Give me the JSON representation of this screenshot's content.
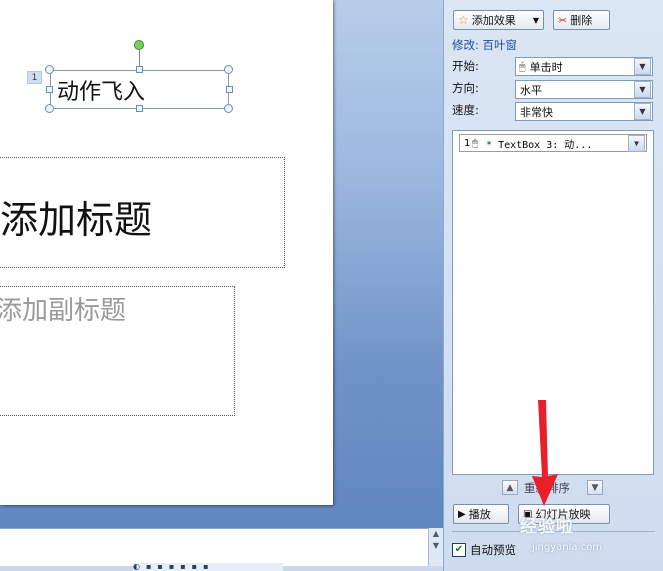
{
  "slide": {
    "textbox_text": "动作飞入",
    "order_tag": "1",
    "title_placeholder": "添加标题",
    "subtitle_placeholder": "添加副标题"
  },
  "pane": {
    "add_effect_label": "添加效果",
    "delete_label": "删除",
    "modify_label": "修改: 百叶窗",
    "start_label": "开始:",
    "start_value": "单击时",
    "direction_label": "方向:",
    "direction_value": "水平",
    "speed_label": "速度:",
    "speed_value": "非常快",
    "list_item": {
      "index": "1",
      "text": "TextBox 3: 动..."
    },
    "reorder_label": "重新排序",
    "play_label": "播放",
    "slideshow_label": "幻灯片放映",
    "autopreview_label": "自动预览",
    "autopreview_checked": true
  },
  "watermark": {
    "text": "经验啦",
    "url": "jingyanla.com"
  },
  "colors": {
    "accent": "#1a4d9c",
    "arrow": "#e8202a",
    "pane_bg": "#dbe6f4"
  },
  "icons": [
    "add-effect-star-icon",
    "delete-icon",
    "mouse-click-icon",
    "effect-star-icon",
    "chevron-down-icon",
    "move-up-icon",
    "move-down-icon",
    "play-icon",
    "slideshow-icon",
    "check-icon"
  ]
}
